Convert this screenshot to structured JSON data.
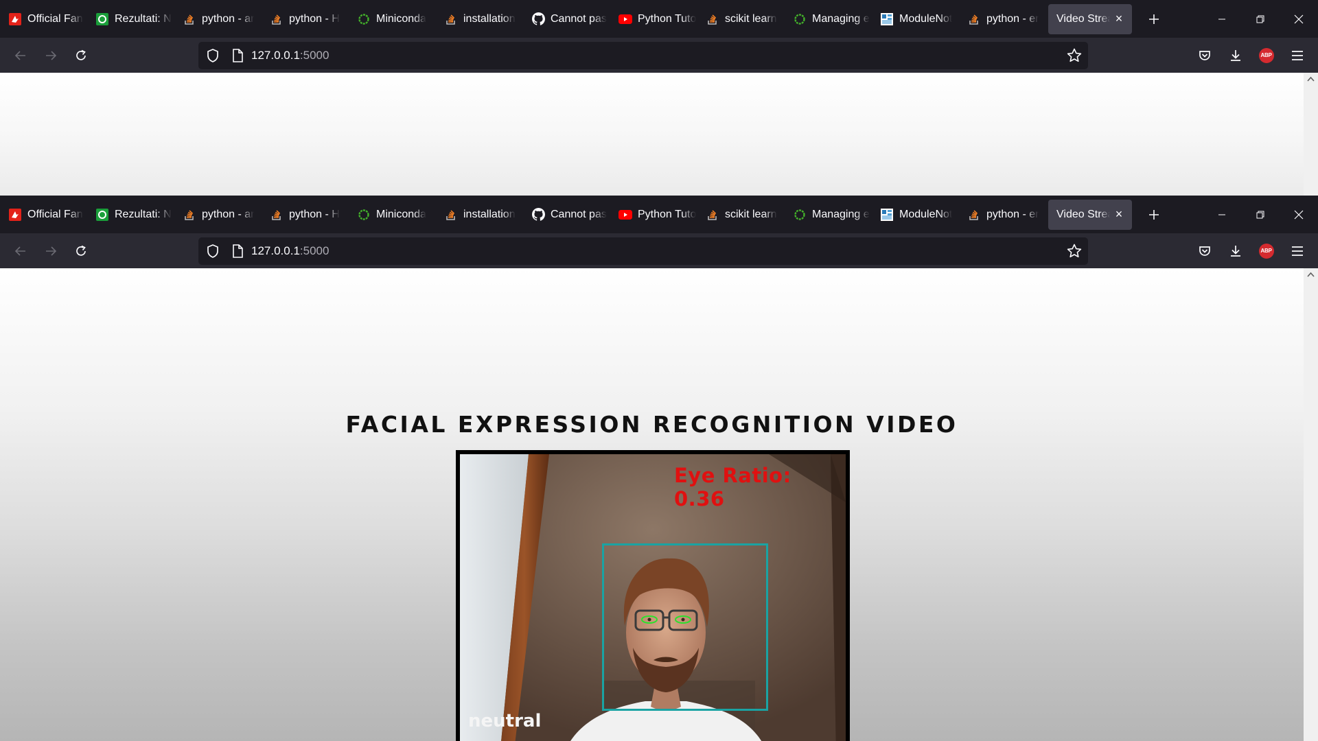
{
  "tabs": [
    {
      "label": "Official Fan",
      "icon": "official-fan-favicon"
    },
    {
      "label": "Rezultati: N",
      "icon": "rezultati-favicon"
    },
    {
      "label": "python - ar",
      "icon": "stackoverflow-icon"
    },
    {
      "label": "python - H",
      "icon": "stackoverflow-icon"
    },
    {
      "label": "Miniconda",
      "icon": "conda-icon"
    },
    {
      "label": "installation",
      "icon": "stackoverflow-icon"
    },
    {
      "label": "Cannot pas",
      "icon": "github-icon"
    },
    {
      "label": "Python Tuto",
      "icon": "youtube-icon"
    },
    {
      "label": "scikit learn",
      "icon": "stackoverflow-icon"
    },
    {
      "label": "Managing e",
      "icon": "conda-icon"
    },
    {
      "label": "ModuleNot",
      "icon": "module-favicon"
    },
    {
      "label": "python - er",
      "icon": "stackoverflow-icon"
    }
  ],
  "active_tab": {
    "label": "Video Stream",
    "close": "×"
  },
  "url": {
    "host": "127.0.0.1",
    "port": ":5000"
  },
  "page": {
    "title": "FACIAL EXPRESSION RECOGNITION VIDEO",
    "overlay": {
      "eye_ratio": "Eye Ratio: 0.36",
      "emotion": "neutral"
    }
  },
  "colors": {
    "tabbar_bg": "#1c1b22",
    "navbar_bg": "#2b2a33",
    "active_tab_bg": "#42414d",
    "overlay_red": "#e01010",
    "face_box": "#1aa3a3"
  }
}
